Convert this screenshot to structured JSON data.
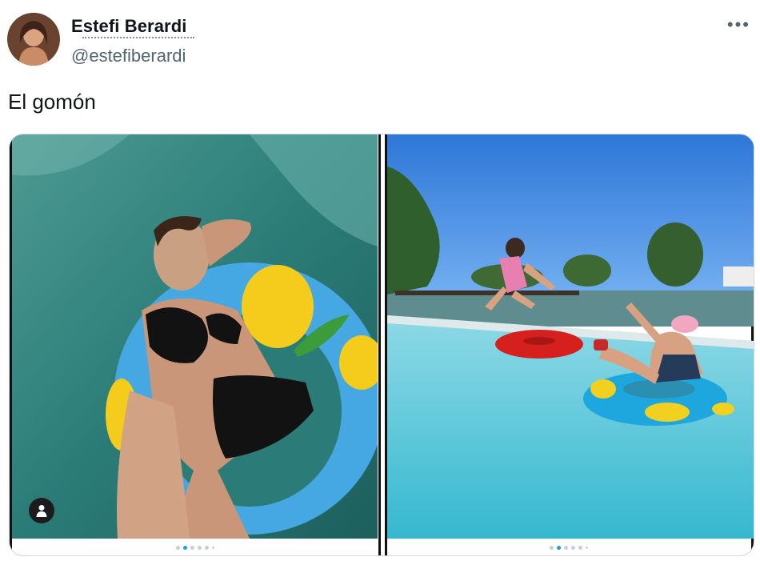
{
  "author": {
    "display_name": "Estefi Berardi",
    "handle": "@estefiberardi",
    "avatar_icon": "profile-avatar"
  },
  "menu": {
    "more_label": "•••"
  },
  "tweet": {
    "text": "El gomón"
  },
  "media": {
    "left_photo": {
      "description_icon": "photo-pool-float",
      "carousel_active_index": 1,
      "carousel_count": 6
    },
    "right_photo": {
      "description_icon": "photo-kids-pool",
      "carousel_active_index": 1,
      "carousel_count": 6
    },
    "user_tag_icon": "person-icon"
  },
  "colors": {
    "accent": "#1d9bf0",
    "secondary_text": "#536471"
  }
}
